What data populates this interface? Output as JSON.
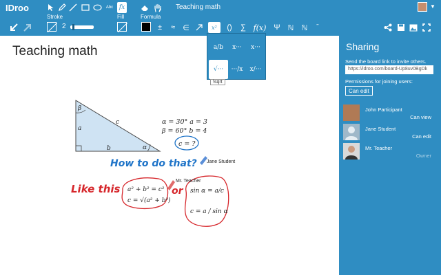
{
  "app": {
    "logo": "IDroo",
    "doc_title": "Teaching math"
  },
  "toolbar": {
    "stroke_label": "Stroke",
    "fill_label": "Fill",
    "formula_label": "Formula",
    "stroke_width": "2",
    "text_tool": "Abc",
    "fx_tool": "fx",
    "stroke_fraction": 0.1,
    "stroke_color": "#ffffff",
    "fill_color": "#ffffff",
    "formula_color": "#000000",
    "formula_symbols": {
      "plusminus": "±",
      "approx": "≈",
      "element_of": "∈",
      "superscript": "x²",
      "parens": "()",
      "sum": "∑",
      "function": "f(x)",
      "psi": "Ψ",
      "naturals": "ℕ",
      "naturals_alt": "ℕ",
      "accent": "ˉ"
    }
  },
  "formula_menu": {
    "items": [
      "a/b",
      "x···",
      "x···",
      "√···",
      "···/x",
      "x/···"
    ],
    "tooltip": "\\sqrt"
  },
  "canvas": {
    "title": "Teaching math",
    "triangle": {
      "beta": "β",
      "alpha": "α",
      "a": "a",
      "b": "b",
      "c": "c"
    },
    "given_1": "α = 30°   a = 3",
    "given_2": "β = 60°   b = 4",
    "question": "c = ?",
    "handwriting_1": "How to do that?",
    "author_1": "Jane Student",
    "handwriting_2": "Like this",
    "or_word": "or",
    "author_2": "Mr. Teacher",
    "formula_1": "a² + b² = c²",
    "formula_2": "c = √(a² + b²)",
    "formula_3": "sin α = a/c",
    "formula_4": "c = a / sin α"
  },
  "sharing": {
    "title": "Sharing",
    "send_text": "Send the board link to invite others.",
    "link": "https://idroo.com/board-Up8uv0BgDk",
    "permissions_text": "Permissions for joining users:",
    "permission_button": "Can edit",
    "users": [
      {
        "name": "John Participant",
        "role": "Can view",
        "avatar_color": "#b07a55"
      },
      {
        "name": "Jane Student",
        "role": "Can edit",
        "avatar_color": "#9fb8c9"
      },
      {
        "name": "Mr. Teacher",
        "role": "Owner",
        "avatar_color": "#d9d9d9"
      }
    ]
  },
  "colors": {
    "accent": "#2f8dc2",
    "red_ink": "#d6262b",
    "blue_ink": "#1f74c8",
    "triangle_fill": "#cfe3f3"
  }
}
